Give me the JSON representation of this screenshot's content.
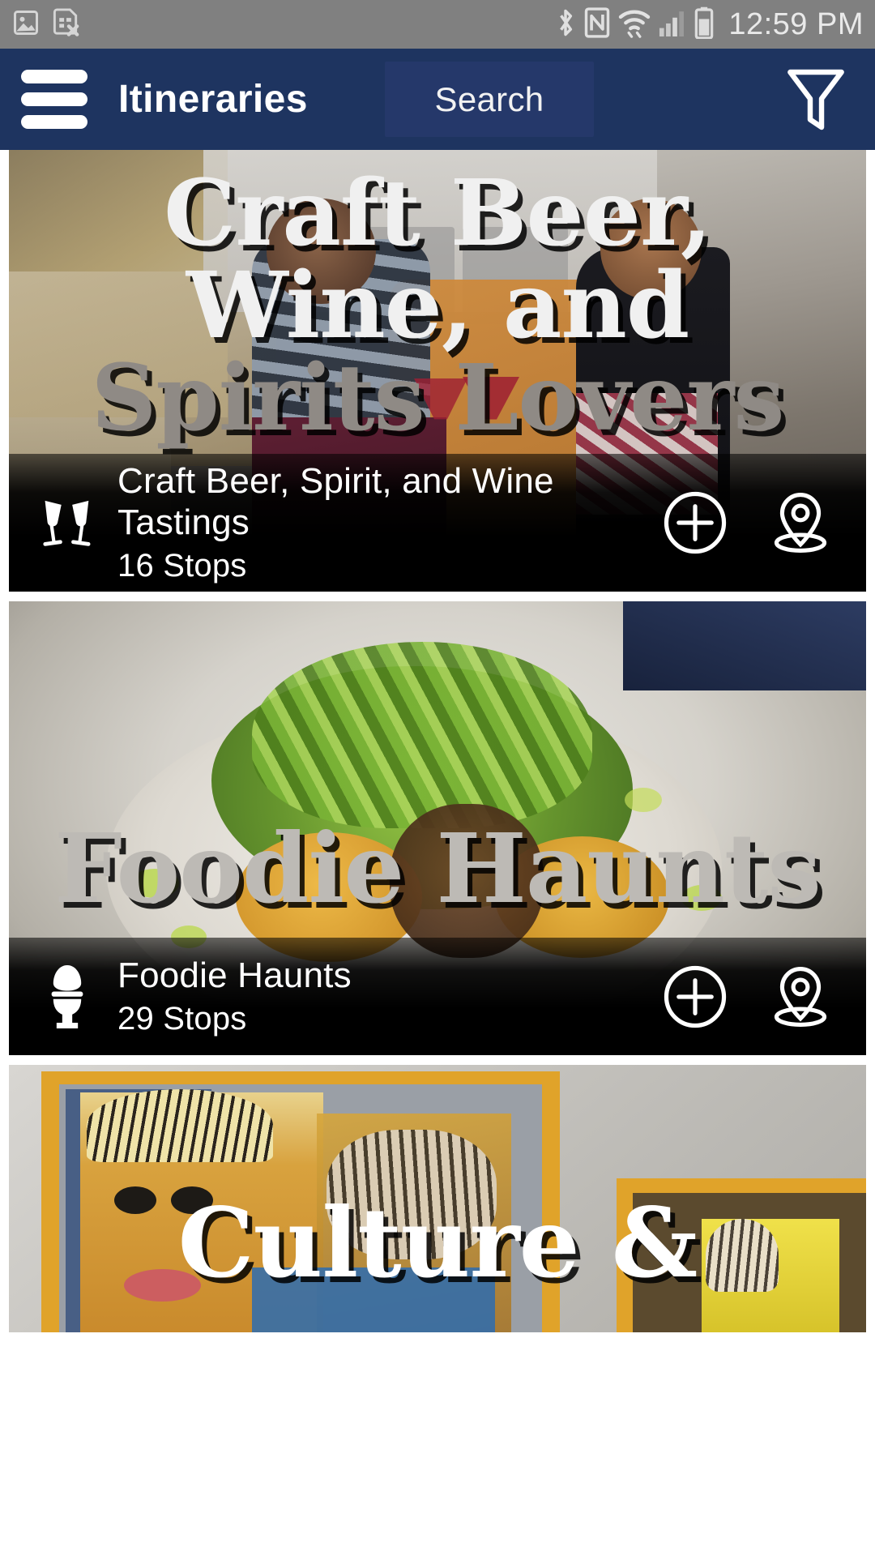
{
  "status_bar": {
    "time": "12:59 PM",
    "left_icons": [
      "image-icon",
      "sim-card-error-icon"
    ],
    "right_icons": [
      "bluetooth-icon",
      "nfc-icon",
      "wifi-icon",
      "cellular-signal-icon",
      "battery-icon"
    ],
    "background_color": "#808080"
  },
  "app_bar": {
    "menu_icon": "hamburger-menu-icon",
    "title": "Itineraries",
    "search_label": "Search",
    "filter_icon": "funnel-filter-icon",
    "background_color": "#1e3460",
    "search_background_color": "#25386a"
  },
  "cards": [
    {
      "hero_text": "Craft Beer, Wine, and Spirits Lovers",
      "hero_lines": [
        "Craft Beer,",
        "Wine, and",
        "Spirits Lovers"
      ],
      "title": "Craft Beer, Spirit, and Wine Tastings",
      "stops": "16 Stops",
      "category_icon": "wine-glasses-toast-icon",
      "add_icon": "plus-circle-icon",
      "map_icon": "map-pin-icon"
    },
    {
      "hero_text": "Foodie Haunts",
      "hero_lines": [
        "Foodie Haunts"
      ],
      "title": "Foodie Haunts",
      "stops": "29 Stops",
      "category_icon": "egg-cup-icon",
      "add_icon": "plus-circle-icon",
      "map_icon": "map-pin-icon"
    },
    {
      "hero_text": "Culture &",
      "hero_lines": [
        "Culture &"
      ],
      "title": "",
      "stops": "",
      "category_icon": "",
      "add_icon": "plus-circle-icon",
      "map_icon": "map-pin-icon"
    }
  ]
}
